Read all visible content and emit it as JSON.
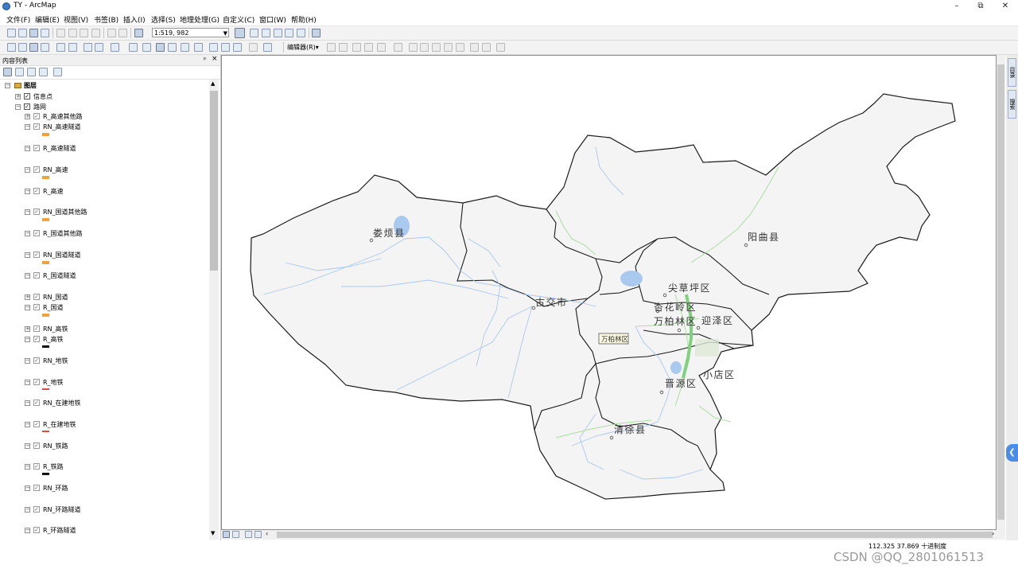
{
  "window": {
    "title": "TY - ArcMap"
  },
  "menu": [
    "文件(F)",
    "编辑(E)",
    "视图(V)",
    "书签(B)",
    "插入(I)",
    "选择(S)",
    "地理处理(G)",
    "自定义(C)",
    "窗口(W)",
    "帮助(H)"
  ],
  "toolbar": {
    "scale": "1:519, 982",
    "editor_label": "编辑器(R)▾"
  },
  "toc": {
    "title": "内容列表",
    "pin": "ᵖ",
    "close": "×",
    "root": "图层",
    "groups": [
      {
        "label": "信息点",
        "expanded": false
      },
      {
        "label": "路网",
        "expanded": true
      }
    ],
    "layers": [
      "R_高速其他路",
      "RN_高速隧道",
      "R_高速隧道",
      "RN_高速",
      "R_高速",
      "RN_国道其他路",
      "R_国道其他路",
      "RN_国道隧道",
      "R_国道隧道",
      "RN_国道",
      "R_国道",
      "RN_高铁",
      "R_高铁",
      "RN_地铁",
      "R_地铁",
      "RN_在建地铁",
      "R_在建地铁",
      "RN_铁路",
      "R_铁路",
      "RN_环路",
      "RN_环路隧道",
      "R_环路隧道"
    ]
  },
  "map": {
    "labels": [
      "娄烦县",
      "古交市",
      "阳曲县",
      "尖草坪区",
      "杏花岭区",
      "万柏林区",
      "迎泽区",
      "小店区",
      "晋源区",
      "清徐县"
    ],
    "tooltip": "万柏林区",
    "colors": {
      "land": "#f4f4f4",
      "boundary": "#1a1a1a",
      "water": "#a9c9ef",
      "green": "#a9e0a0"
    }
  },
  "dock": {
    "tab1": "目录",
    "tab2": "搜索"
  },
  "status": {
    "coords": "112.325  37.869 十进制度",
    "watermark": "CSDN @QQ_2801061513"
  }
}
